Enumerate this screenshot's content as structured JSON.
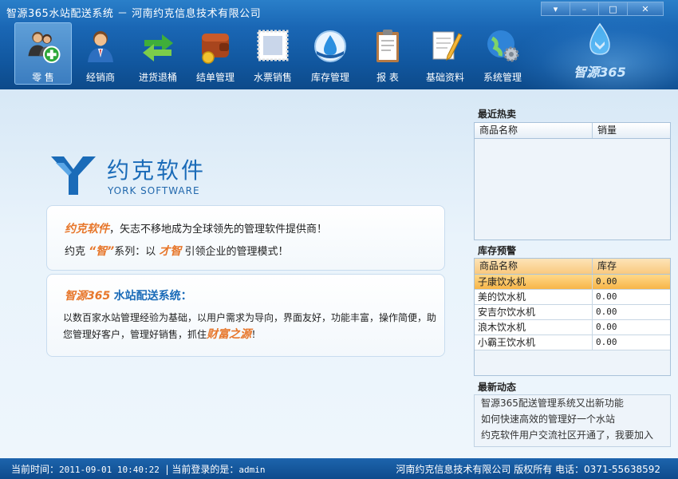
{
  "window": {
    "title": "智源365水站配送系统  －  河南约克信息技术有限公司",
    "controls": {
      "menu": "▾",
      "minimize": "–",
      "maximize": "□",
      "close": "✕"
    }
  },
  "toolbar": [
    {
      "label": "零 售",
      "icon": "retail-user-add-icon",
      "active": true
    },
    {
      "label": "经销商",
      "icon": "dealer-person-icon"
    },
    {
      "label": "进货退桶",
      "icon": "exchange-arrows-icon"
    },
    {
      "label": "结单管理",
      "icon": "wallet-coin-icon"
    },
    {
      "label": "水票销售",
      "icon": "stamp-ticket-icon"
    },
    {
      "label": "库存管理",
      "icon": "water-drop-globe-icon"
    },
    {
      "label": "报 表",
      "icon": "clipboard-report-icon"
    },
    {
      "label": "基础资料",
      "icon": "notepad-pencil-icon"
    },
    {
      "label": "系统管理",
      "icon": "globe-gear-icon"
    }
  ],
  "brand": {
    "name": "智源365"
  },
  "company_logo": {
    "cn": "约克软件",
    "en": "YORK SOFTWARE"
  },
  "card1": {
    "line1_highlight": "约克软件",
    "line1_text": "，矢志不移地成为全球领先的管理软件提供商！",
    "line2_prefix": "约克",
    "line2_quote": "“智”",
    "line2_mid": "系列：以",
    "line2_highlight": "才智",
    "line2_suffix": "引领企业的管理模式！"
  },
  "card2": {
    "title_highlight": "智源365",
    "title_text": "水站配送系统：",
    "body_text": "以数百家水站管理经验为基础，以用户需求为导向，界面友好，功能丰富，操作简便，助您管理好客户，管理好销售，抓住",
    "body_highlight": "财富之源",
    "body_end": "！"
  },
  "hot_sales": {
    "title": "最近热卖",
    "headers": [
      "商品名称",
      "销量"
    ],
    "rows": []
  },
  "stock_alert": {
    "title": "库存预警",
    "headers": [
      "商品名称",
      "库存"
    ],
    "rows": [
      {
        "name": "子康饮水机",
        "stock": "0.00",
        "selected": true
      },
      {
        "name": "美的饮水机",
        "stock": "0.00"
      },
      {
        "name": "安吉尔饮水机",
        "stock": "0.00"
      },
      {
        "name": "浪木饮水机",
        "stock": "0.00"
      },
      {
        "name": "小霸王饮水机",
        "stock": "0.00"
      }
    ]
  },
  "news": {
    "title": "最新动态",
    "items": [
      "智源365配送管理系统又出新功能",
      "如何快速高效的管理好一个水站",
      "约克软件用户交流社区开通了，我要加入"
    ]
  },
  "statusbar": {
    "time_label": "当前时间：",
    "time_value": "2011-09-01 10:40:22",
    "separator": "|",
    "login_label": "当前登录的是：",
    "login_value": "admin",
    "right_text": "河南约克信息技术有限公司  版权所有  电话：0371-55638592"
  },
  "colors": {
    "accent": "#1a6bb8",
    "highlight": "#e7762a",
    "header": "#11579f"
  }
}
